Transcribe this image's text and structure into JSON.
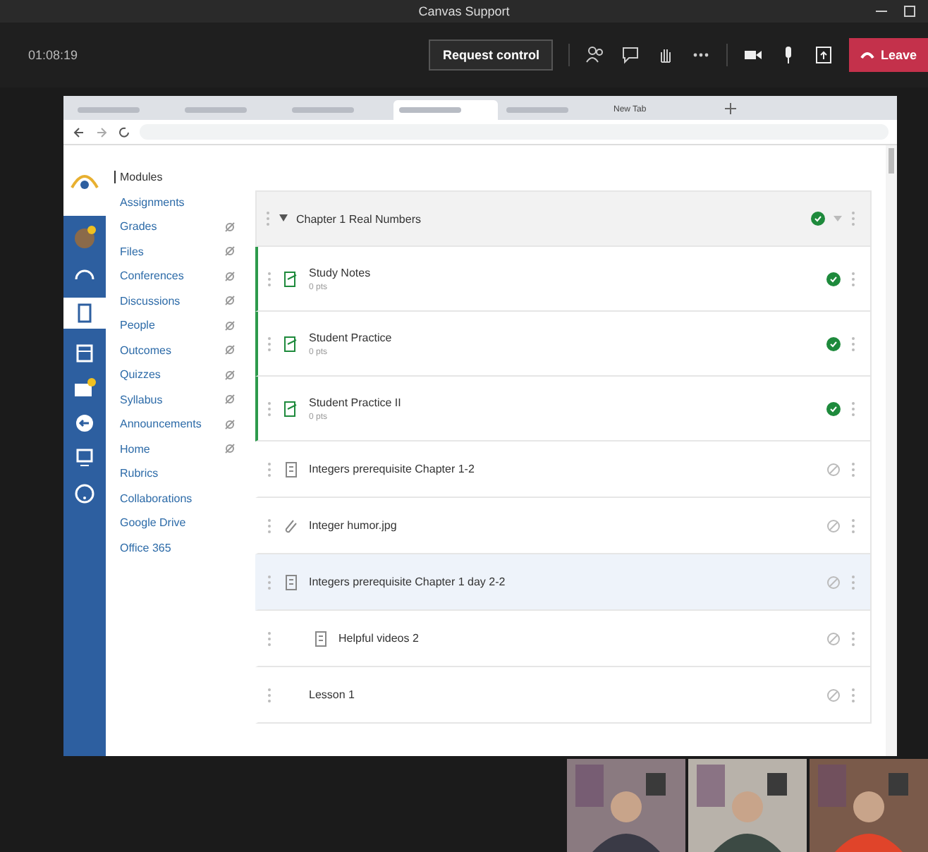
{
  "meeting": {
    "title": "Canvas Support",
    "timer": "01:08:19",
    "request_control": "Request control",
    "leave": "Leave"
  },
  "browser": {
    "tabs": [
      {
        "selected": false
      },
      {
        "selected": false
      },
      {
        "selected": false
      },
      {
        "selected": true
      },
      {
        "selected": false
      },
      {
        "label": "New Tab",
        "selected": false
      }
    ]
  },
  "course_nav": [
    {
      "label": "Modules",
      "selected": true,
      "hidden": false
    },
    {
      "label": "Assignments",
      "selected": false,
      "hidden": false
    },
    {
      "label": "Grades",
      "selected": false,
      "hidden": true
    },
    {
      "label": "Files",
      "selected": false,
      "hidden": true
    },
    {
      "label": "Conferences",
      "selected": false,
      "hidden": true
    },
    {
      "label": "Discussions",
      "selected": false,
      "hidden": true
    },
    {
      "label": "People",
      "selected": false,
      "hidden": true
    },
    {
      "label": "Outcomes",
      "selected": false,
      "hidden": true
    },
    {
      "label": "Quizzes",
      "selected": false,
      "hidden": true
    },
    {
      "label": "Syllabus",
      "selected": false,
      "hidden": true
    },
    {
      "label": "Announcements",
      "selected": false,
      "hidden": true
    },
    {
      "label": "Home",
      "selected": false,
      "hidden": true
    },
    {
      "label": "Rubrics",
      "selected": false,
      "hidden": false
    },
    {
      "label": "Collaborations",
      "selected": false,
      "hidden": false
    },
    {
      "label": "Google Drive",
      "selected": false,
      "hidden": false
    },
    {
      "label": "Office 365",
      "selected": false,
      "hidden": false
    }
  ],
  "module": {
    "title": "Chapter 1 Real Numbers",
    "published": true,
    "items": [
      {
        "kind": "assignment",
        "title": "Study Notes",
        "sub": "0 pts",
        "published": true,
        "selected": false
      },
      {
        "kind": "assignment",
        "title": "Student Practice",
        "sub": "0 pts",
        "published": true,
        "selected": false
      },
      {
        "kind": "assignment",
        "title": "Student Practice II",
        "sub": "0 pts",
        "published": true,
        "selected": false
      },
      {
        "kind": "page",
        "title": "Integers prerequisite Chapter 1-2",
        "published": false,
        "selected": false
      },
      {
        "kind": "file",
        "title": "Integer humor.jpg",
        "published": false,
        "selected": false
      },
      {
        "kind": "page",
        "title": "Integers prerequisite Chapter 1 day 2-2",
        "published": false,
        "selected": true
      },
      {
        "kind": "page",
        "title": "Helpful videos 2",
        "published": false,
        "selected": false,
        "indented": true
      },
      {
        "kind": "subheader",
        "title": "Lesson 1",
        "published": false,
        "selected": false
      }
    ]
  }
}
